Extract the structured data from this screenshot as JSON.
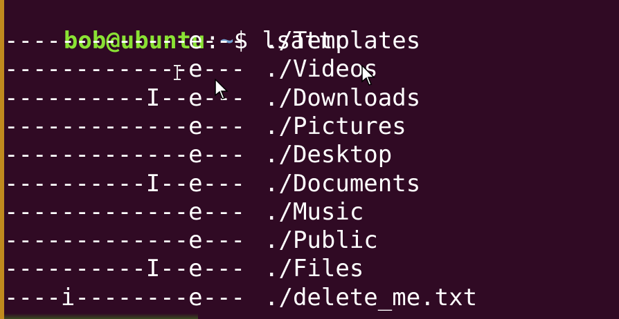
{
  "terminal": {
    "prompt": {
      "user_host": "bob@ubuntu",
      "colon": ":",
      "path": "~",
      "dollar": "$",
      "command": " lsattr"
    },
    "rows": [
      {
        "attrs": "-------------e---",
        "file": "./Templates"
      },
      {
        "attrs": "-------------e---",
        "file": "./Videos"
      },
      {
        "attrs": "----------I--e---",
        "file": "./Downloads"
      },
      {
        "attrs": "-------------e---",
        "file": "./Pictures"
      },
      {
        "attrs": "-------------e---",
        "file": "./Desktop"
      },
      {
        "attrs": "----------I--e---",
        "file": "./Documents"
      },
      {
        "attrs": "-------------e---",
        "file": "./Music"
      },
      {
        "attrs": "-------------e---",
        "file": "./Public"
      },
      {
        "attrs": "----------I--e---",
        "file": "./Files"
      },
      {
        "attrs": "----i--------e---",
        "file": "./delete_me.txt"
      }
    ]
  },
  "colors": {
    "background": "#300a24",
    "prompt_user": "#8ae234",
    "prompt_path": "#729fcf",
    "text": "#ffffff",
    "left_border": "#c08a1e"
  },
  "icons": {
    "mouse_pointer": "arrow-pointer-icon",
    "text_cursor": "ibeam-cursor-icon"
  }
}
